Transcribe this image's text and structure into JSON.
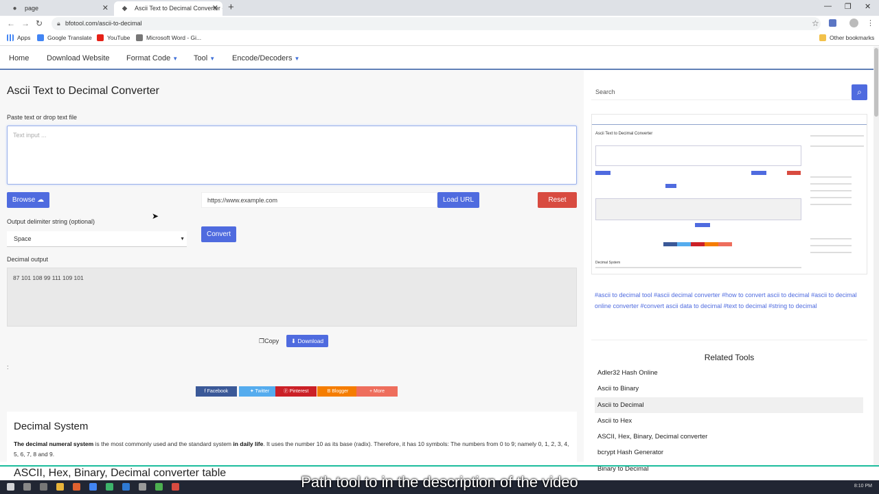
{
  "browser": {
    "tabs": [
      {
        "title": "page",
        "active": false
      },
      {
        "title": "Ascii Text to Decimal Converter -",
        "active": true
      }
    ],
    "url": "bfotool.com/ascii-to-decimal",
    "bookmarks": [
      "Apps",
      "Google Translate",
      "YouTube",
      "Microsoft Word - Gi...",
      "Other bookmarks"
    ]
  },
  "nav": {
    "items": [
      "Home",
      "Download Website",
      "Format Code",
      "Tool",
      "Encode/Decoders"
    ]
  },
  "main": {
    "title": "Ascii Text to Decimal Converter",
    "paste_label": "Paste text or drop text file",
    "input_placeholder": "Text input ...",
    "browse_label": "Browse",
    "url_placeholder": "https://www.example.com",
    "load_url_label": "Load URL",
    "reset_label": "Reset",
    "delimiter_label": "Output delimiter string (optional)",
    "delimiter_value": "Space",
    "convert_label": "Convert",
    "output_label": "Decimal output",
    "output_value": "87 101 108 99 111 109 101",
    "copy_label": "Copy",
    "download_label": "Download",
    "colon": ":",
    "share": [
      "Facebook",
      "Twitter",
      "Pinterest",
      "Blogger",
      "More"
    ],
    "desc_title": "Decimal System",
    "desc_bold1": "The decimal numeral system",
    "desc_mid1": " is the most commonly used and the standard system ",
    "desc_bold2": "in daily life",
    "desc_rest": ". It uses the number 10 as its base (radix). Therefore, it has 10 symbols: The numbers from 0 to 9; namely 0, 1, 2, 3, 4, 5, 6, 7, 8 and 9.",
    "desc_title2": "ASCII, Hex, Binary, Decimal converter table"
  },
  "sidebar": {
    "search_placeholder": "Search",
    "thumb_title": "Ascii Text to Decimal Converter",
    "thumb_section": "Decimal System",
    "tags": "#ascii to decimal tool  #ascii decimal converter  #how to convert ascii to decimal  #ascii to decimal online converter  #convert ascii data to decimal  #text to decimal  #string to decimal",
    "related_title": "Related Tools",
    "related": [
      "Adler32 Hash Online",
      "Ascii to Binary",
      "Ascii to Decimal",
      "Ascii to Hex",
      "ASCII, Hex, Binary, Decimal converter",
      "bcrypt Hash Generator",
      "Binary to Decimal"
    ]
  },
  "overlay": {
    "caption": "Path tool to in the description of the video",
    "time": "8:10 PM"
  },
  "colors": {
    "accent_blue": "#4f6bdf",
    "reset_red": "#d84b40",
    "nav_border": "#5f7fb6"
  }
}
